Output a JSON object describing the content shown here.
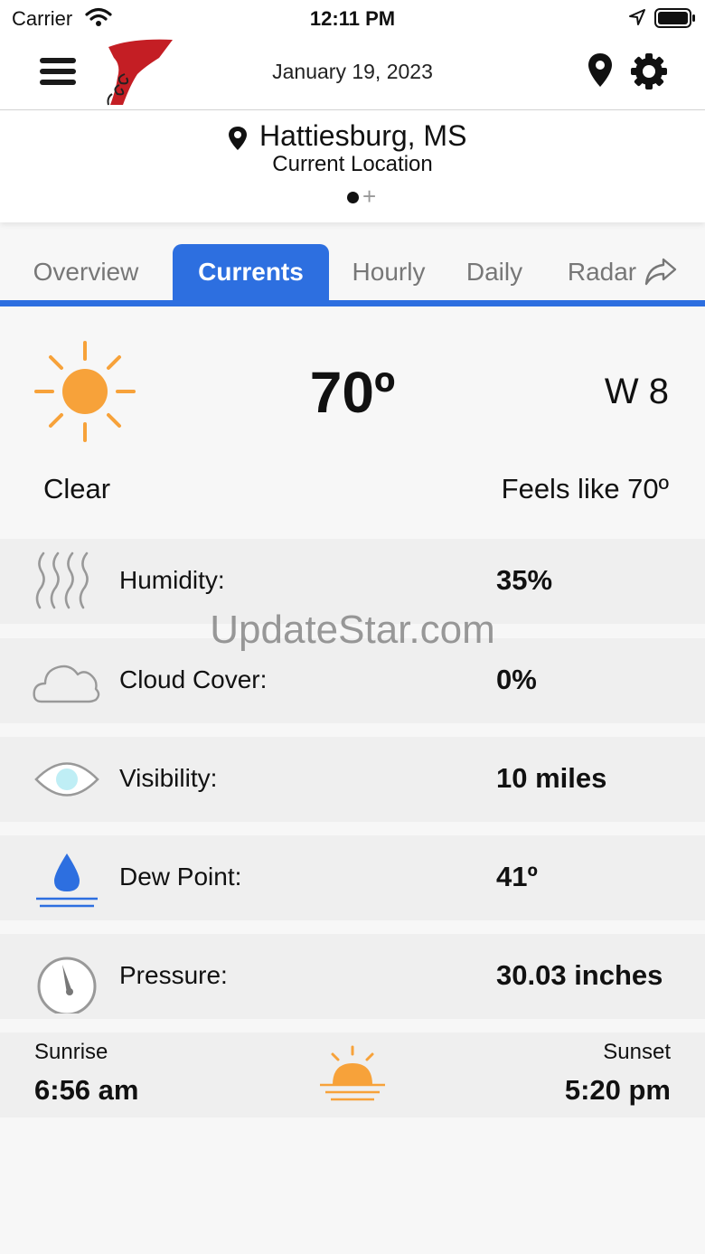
{
  "status": {
    "carrier": "Carrier",
    "time": "12:11 PM"
  },
  "header": {
    "date": "January 19, 2023"
  },
  "location": {
    "city": "Hattiesburg, MS",
    "subtitle": "Current Location"
  },
  "tabs": [
    {
      "label": "Overview",
      "active": false
    },
    {
      "label": "Currents",
      "active": true
    },
    {
      "label": "Hourly",
      "active": false
    },
    {
      "label": "Daily",
      "active": false
    },
    {
      "label": "Radar",
      "active": false
    }
  ],
  "current": {
    "temperature": "70º",
    "wind": "W 8",
    "condition": "Clear",
    "feels_like": "Feels like 70º"
  },
  "details": [
    {
      "icon": "humidity-icon",
      "label": "Humidity:",
      "value": "35%"
    },
    {
      "icon": "cloud-icon",
      "label": "Cloud Cover:",
      "value": "0%"
    },
    {
      "icon": "eye-icon",
      "label": "Visibility:",
      "value": "10 miles"
    },
    {
      "icon": "dew-drop-icon",
      "label": "Dew Point:",
      "value": "41º"
    },
    {
      "icon": "gauge-icon",
      "label": "Pressure:",
      "value": "30.03 inches"
    }
  ],
  "sun": {
    "sunrise_label": "Sunrise",
    "sunrise_time": "6:56 am",
    "sunset_label": "Sunset",
    "sunset_time": "5:20 pm"
  },
  "watermark": "UpdateStar.com",
  "colors": {
    "accent": "#2d6fe0",
    "sun": "#f7a23a",
    "dew": "#2d6fe0",
    "eye": "#bfeef5"
  }
}
